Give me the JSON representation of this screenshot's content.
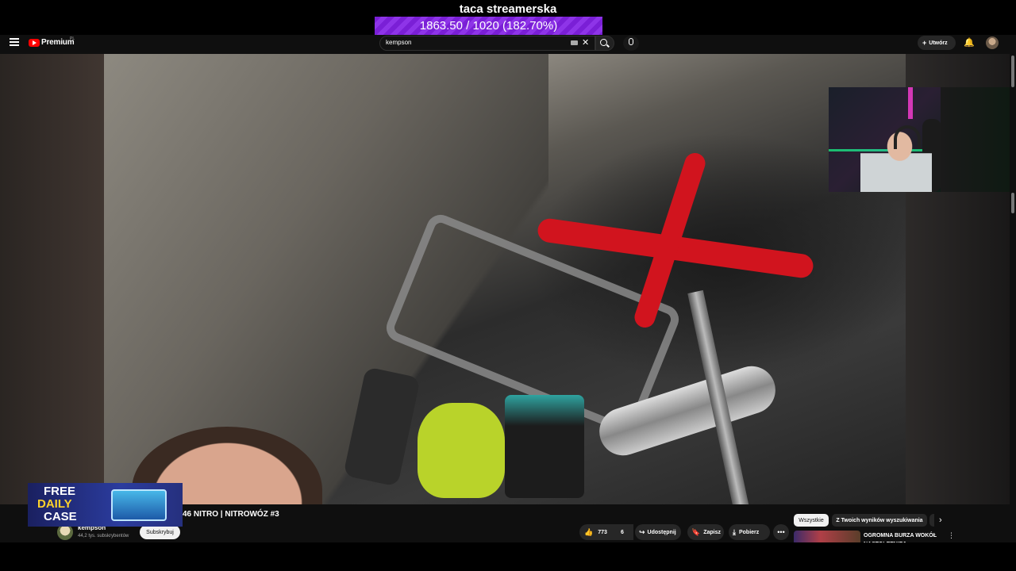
{
  "overlay": {
    "goal_title": "taca streamerska",
    "goal_progress": "1863.50 / 1020 (182.70%)"
  },
  "topbar": {
    "logo_text": "Premium",
    "logo_region": "PL",
    "search_value": "kempson",
    "create_label": "Utwórz"
  },
  "ad": {
    "line1": "FREE",
    "line2": "DAILY",
    "line3": "CASE"
  },
  "video": {
    "title": "46 NITRO | NITROWÓZ #3"
  },
  "channel": {
    "name": "kempson",
    "subscribers": "44,2 tys. subskrybentów",
    "subscribe_label": "Subskrybuj"
  },
  "actions": {
    "likes": "773",
    "dislikes": "6",
    "share_label": "Udostępnij",
    "save_label": "Zapisz",
    "download_label": "Pobierz"
  },
  "related": {
    "chips": [
      "Wszystkie",
      "Z Twoich wyników wyszukiwania"
    ],
    "first_title": "OGROMNA BURZA WOKÓŁ NASTOLETNIEJ"
  },
  "colors": {
    "goal_bar": "#8e34e8",
    "yt_red": "#ff0000",
    "tool_red": "#d1141e"
  },
  "icons": [
    "menu-icon",
    "youtube-logo-icon",
    "keyboard-icon",
    "close-icon",
    "search-icon",
    "mic-icon",
    "plus-icon",
    "bell-icon",
    "thumb-up-icon",
    "thumb-down-icon",
    "share-icon",
    "bookmark-icon",
    "download-icon",
    "more-icon",
    "chevron-right-icon",
    "vertical-dots-icon"
  ]
}
